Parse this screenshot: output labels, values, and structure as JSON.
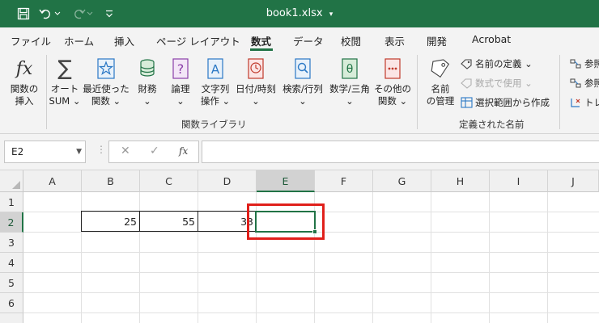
{
  "titlebar": {
    "title": "book1.xlsx",
    "icons": [
      "save-icon",
      "undo-icon",
      "redo-icon",
      "customize-quick-access-icon",
      "title-dropdown-icon"
    ]
  },
  "tabs": [
    {
      "label": "ファイル"
    },
    {
      "label": "ホーム"
    },
    {
      "label": "挿入"
    },
    {
      "label": "ページ レイアウト"
    },
    {
      "label": "数式",
      "active": true
    },
    {
      "label": "データ"
    },
    {
      "label": "校閲"
    },
    {
      "label": "表示"
    },
    {
      "label": "開発"
    },
    {
      "label": "Acrobat"
    }
  ],
  "ribbon": {
    "function_library": {
      "group_label": "関数ライブラリ",
      "buttons": [
        {
          "line1": "関数の",
          "line2": "挿入",
          "icon": "fx-icon"
        },
        {
          "line1": "オート",
          "line2": "SUM ⌄",
          "icon": "sigma-icon"
        },
        {
          "line1": "最近使った",
          "line2": "関数 ⌄",
          "icon": "star-icon"
        },
        {
          "line1": "財務",
          "line2": "⌄",
          "icon": "financial-icon"
        },
        {
          "line1": "論理",
          "line2": "⌄",
          "icon": "logical-icon"
        },
        {
          "line1": "文字列",
          "line2": "操作 ⌄",
          "icon": "text-icon"
        },
        {
          "line1": "日付/時刻",
          "line2": "⌄",
          "icon": "datetime-icon"
        },
        {
          "line1": "検索/行列",
          "line2": "⌄",
          "icon": "lookup-icon"
        },
        {
          "line1": "数学/三角",
          "line2": "⌄",
          "icon": "math-icon"
        },
        {
          "line1": "その他の",
          "line2": "関数 ⌄",
          "icon": "more-functions-icon"
        }
      ]
    },
    "defined_names": {
      "group_label": "定義された名前",
      "name_manager": {
        "line1": "名前",
        "line2": "の管理"
      },
      "define_name": "名前の定義 ⌄",
      "use_in_formula": "数式で使用 ⌄",
      "create_from_selection": "選択範囲から作成"
    },
    "formula_auditing": {
      "items": [
        "参照",
        "参照",
        "トレ"
      ]
    }
  },
  "formula_bar": {
    "name_box": "E2",
    "dots": "⋮",
    "cancel": "✕",
    "enter": "✓",
    "fx": "fx",
    "content": ""
  },
  "sheet": {
    "columns": [
      "A",
      "B",
      "C",
      "D",
      "E",
      "F",
      "G",
      "H",
      "I",
      "J"
    ],
    "rows": [
      "1",
      "2",
      "3",
      "4",
      "5",
      "6"
    ],
    "selected_cell": "E2",
    "cells": {
      "B2": "25",
      "C2": "55",
      "D2": "33"
    }
  },
  "colors": {
    "accent": "#217346",
    "highlight_box": "#e0201b"
  }
}
